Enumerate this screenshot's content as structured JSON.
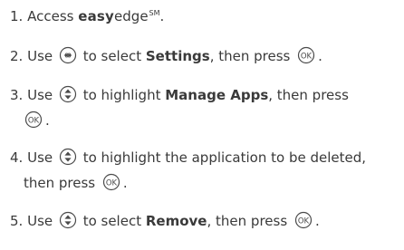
{
  "steps": [
    {
      "number": "1.",
      "access_text": "Access",
      "brand_bold": "easy",
      "brand_rest": "edge",
      "brand_mark": "SM",
      "end": "."
    },
    {
      "number": "2.",
      "use_text": "Use",
      "nav_icon": "left-right-nav-key-icon",
      "mid_text": "to select",
      "target": "Settings",
      "tail_text": ", then press",
      "ok_icon": "ok-key-icon",
      "end": "."
    },
    {
      "number": "3.",
      "use_text": "Use",
      "nav_icon": "up-down-nav-key-icon",
      "mid_text": "to highlight",
      "target": "Manage Apps",
      "tail_text": ", then press",
      "ok_icon": "ok-key-icon",
      "end": "."
    },
    {
      "number": "4.",
      "use_text": "Use",
      "nav_icon": "up-down-nav-key-icon",
      "mid_text": "to highlight the application to be deleted,",
      "tail_text": "then press",
      "ok_icon": "ok-key-icon",
      "end": "."
    },
    {
      "number": "5.",
      "use_text": "Use",
      "nav_icon": "up-down-nav-key-icon",
      "mid_text": "to select",
      "target": "Remove",
      "tail_text": ", then press",
      "ok_icon": "ok-key-icon",
      "end": "."
    }
  ],
  "ok_key_label": "OK",
  "colors": {
    "text": "#3a3a3a",
    "icon_stroke": "#4a4a4a"
  }
}
